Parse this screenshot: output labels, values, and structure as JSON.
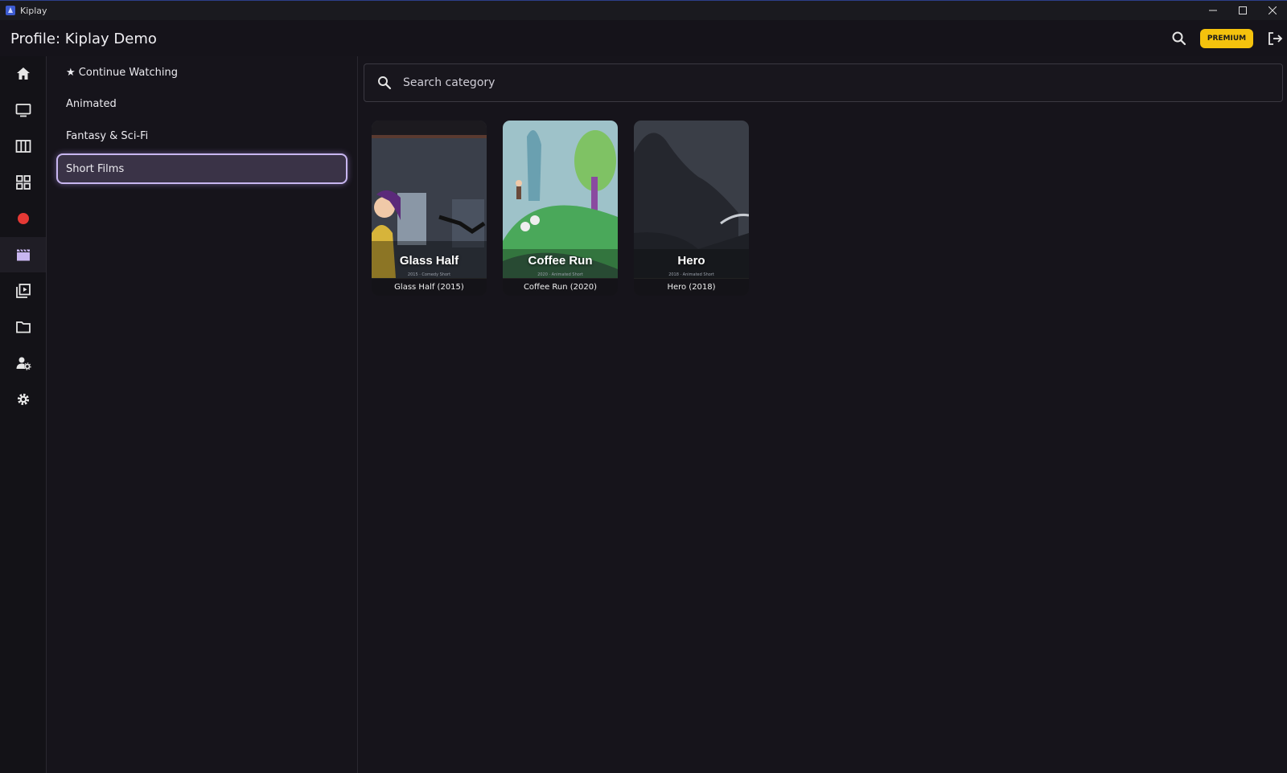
{
  "window": {
    "app_name": "Kiplay"
  },
  "header": {
    "profile_title": "Profile: Kiplay Demo",
    "premium_label": "PREMIUM"
  },
  "rail": {
    "items": [
      {
        "icon": "home-icon"
      },
      {
        "icon": "tv-icon"
      },
      {
        "icon": "columns-icon"
      },
      {
        "icon": "grid-icon"
      },
      {
        "icon": "record-icon"
      },
      {
        "icon": "clapperboard-icon",
        "active": true
      },
      {
        "icon": "video-library-icon"
      },
      {
        "icon": "folder-icon"
      },
      {
        "icon": "user-settings-icon"
      },
      {
        "icon": "gear-icon"
      }
    ]
  },
  "categories": {
    "items": [
      {
        "label": "★ Continue Watching"
      },
      {
        "label": "Animated"
      },
      {
        "label": "Fantasy & Sci-Fi"
      },
      {
        "label": "Short Films",
        "selected": true
      }
    ]
  },
  "search": {
    "placeholder": "Search category"
  },
  "movies": [
    {
      "poster_title": "Glass Half",
      "poster_sub": "2015 · Comedy Short",
      "caption": "Glass Half (2015)"
    },
    {
      "poster_title": "Coffee Run",
      "poster_sub": "2020 · Animated Short",
      "caption": "Coffee Run (2020)"
    },
    {
      "poster_title": "Hero",
      "poster_sub": "2018 · Animated Short",
      "caption": "Hero (2018)"
    }
  ],
  "colors": {
    "accent": "#c8b6f0",
    "premium": "#f4c20d",
    "record": "#e53935",
    "background": "#16141b"
  }
}
